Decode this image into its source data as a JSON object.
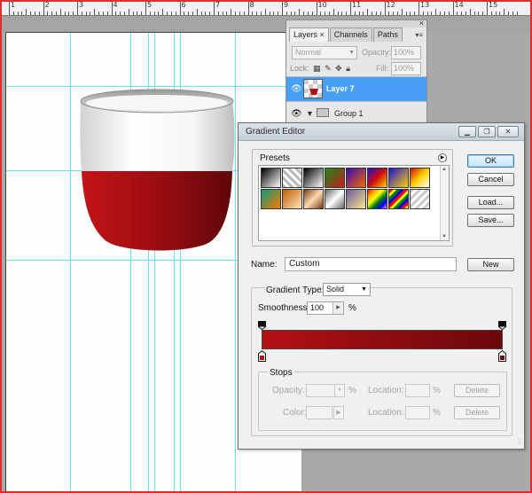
{
  "ruler": {
    "labels": [
      "1",
      "2",
      "3",
      "4",
      "5",
      "6",
      "7",
      "8",
      "9",
      "10",
      "11",
      "12",
      "13",
      "14",
      "15"
    ]
  },
  "layers_panel": {
    "tabs": [
      {
        "label": "Layers ×",
        "active": true
      },
      {
        "label": "Channels",
        "active": false
      },
      {
        "label": "Paths",
        "active": false
      }
    ],
    "blend_mode": "Normal",
    "opacity_label": "Opacity:",
    "opacity_value": "100%",
    "lock_label": "Lock:",
    "fill_label": "Fill:",
    "fill_value": "100%",
    "layers": [
      {
        "name": "Layer 7",
        "selected": true
      },
      {
        "name": "Group 1",
        "selected": false,
        "type": "group"
      }
    ]
  },
  "gradient_editor": {
    "title": "Gradient Editor",
    "window_controls": [
      "minimize-icon",
      "restore-icon",
      "close-icon"
    ],
    "presets_label": "Presets",
    "buttons": {
      "ok": "OK",
      "cancel": "Cancel",
      "load": "Load...",
      "save": "Save...",
      "new": "New"
    },
    "name_label": "Name:",
    "name_value": "Custom",
    "gradient_type_label": "Gradient Type:",
    "gradient_type_value": "Solid",
    "smoothness_label": "Smoothness:",
    "smoothness_value": "100",
    "smoothness_unit": "%",
    "stops": {
      "label": "Stops",
      "opacity_label": "Opacity:",
      "opacity_unit": "%",
      "color_label": "Color:",
      "location_label": "Location:",
      "location_unit": "%",
      "delete_label": "Delete"
    },
    "gradient_colors": {
      "start": "#b41113",
      "end": "#6b080b"
    },
    "color_stops": [
      "#b41113",
      "#6b080b"
    ]
  },
  "colors": {
    "selection_blue": "#47a0f5",
    "guide_cyan": "#6fe0f0",
    "wine_red": "#a80e12",
    "frame_red": "#e22d2d"
  }
}
